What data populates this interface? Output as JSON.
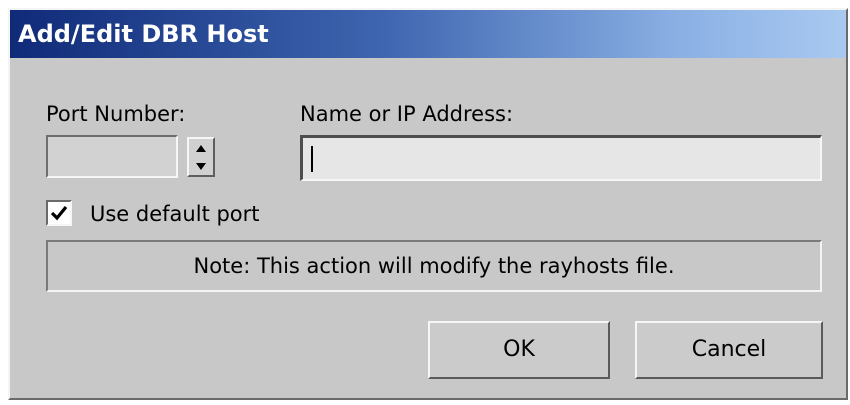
{
  "window": {
    "title": "Add/Edit DBR Host"
  },
  "port": {
    "label": "Port Number:",
    "value": ""
  },
  "address": {
    "label": "Name or IP Address:",
    "value": ""
  },
  "use_default_port": {
    "label": "Use default port",
    "checked": true
  },
  "note": {
    "text": "Note: This action will modify the rayhosts file."
  },
  "buttons": {
    "ok_label": "OK",
    "cancel_label": "Cancel"
  },
  "icons": {
    "spinner_up": "arrow-up-icon",
    "spinner_down": "arrow-down-icon",
    "checkmark": "checkmark-icon"
  },
  "colors": {
    "title_gradient_start": "#0f2a78",
    "title_gradient_end": "#a9c9f0",
    "dialog_background": "#c8c8c8"
  }
}
